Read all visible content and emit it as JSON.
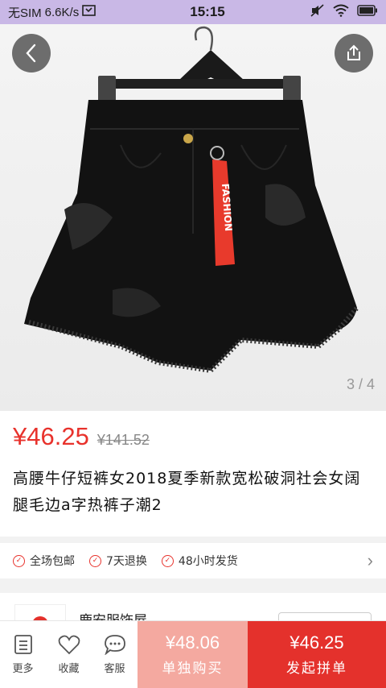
{
  "status_bar": {
    "carrier": "无SIM",
    "speed": "6.6K/s",
    "time": "15:15"
  },
  "gallery": {
    "indicator": "3 / 4",
    "tag_text": "FASHION"
  },
  "product": {
    "price": "¥46.25",
    "original_price": "¥141.52",
    "title": "高腰牛仔短裤女2018夏季新款宽松破洞社会女阔腿毛边a字热裤子潮2"
  },
  "guarantees": [
    "全场包邮",
    "7天退换",
    "48小时发货"
  ],
  "shop": {
    "name": "鹿安服饰屋"
  },
  "bottom_bar": {
    "tabs": [
      {
        "label": "更多",
        "icon": "menu-icon"
      },
      {
        "label": "收藏",
        "icon": "heart-icon"
      },
      {
        "label": "客服",
        "icon": "chat-icon"
      }
    ],
    "buy_alone": {
      "price": "¥48.06",
      "label": "单独购买"
    },
    "group_buy": {
      "price": "¥46.25",
      "label": "发起拼单"
    }
  },
  "colors": {
    "accent": "#e4312c",
    "accent_light": "#f4a9a0",
    "status_bar": "#c9b8e6"
  }
}
